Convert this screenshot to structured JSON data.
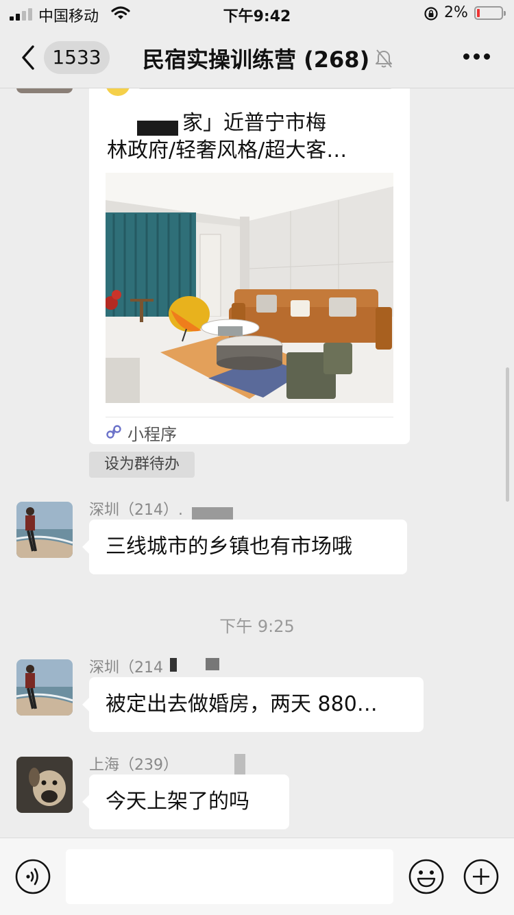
{
  "status_bar": {
    "carrier": "中国移动",
    "time": "下午9:42",
    "battery": "2%"
  },
  "header": {
    "unread_count": "1533",
    "title": "民宿实操训练营 (268)"
  },
  "shared_card": {
    "title_line1": "家」近普宁市梅",
    "title_line2": "林政府/轻奢风格/超大客…",
    "source_label": "小程序"
  },
  "todo_chip_label": "设为群待办",
  "messages": [
    {
      "sender": "深圳（214）.",
      "text": "三线城市的乡镇也有市场哦"
    },
    {
      "sender": "深圳（214",
      "text": "被定出去做婚房，两天 880…"
    },
    {
      "sender": "上海（239）",
      "text": "今天上架了的吗"
    }
  ],
  "time_divider": "下午 9:25",
  "input": {
    "placeholder": ""
  },
  "icons": {
    "back": "chevron-left-icon",
    "mute": "bell-slash-icon",
    "more": "ellipsis-icon",
    "voice": "voice-icon",
    "emoji": "smiley-icon",
    "plus": "plus-circle-icon",
    "mini_program": "mini-program-icon"
  },
  "colors": {
    "background": "#ededed",
    "bubble": "#ffffff",
    "battery_low": "#e33333"
  }
}
